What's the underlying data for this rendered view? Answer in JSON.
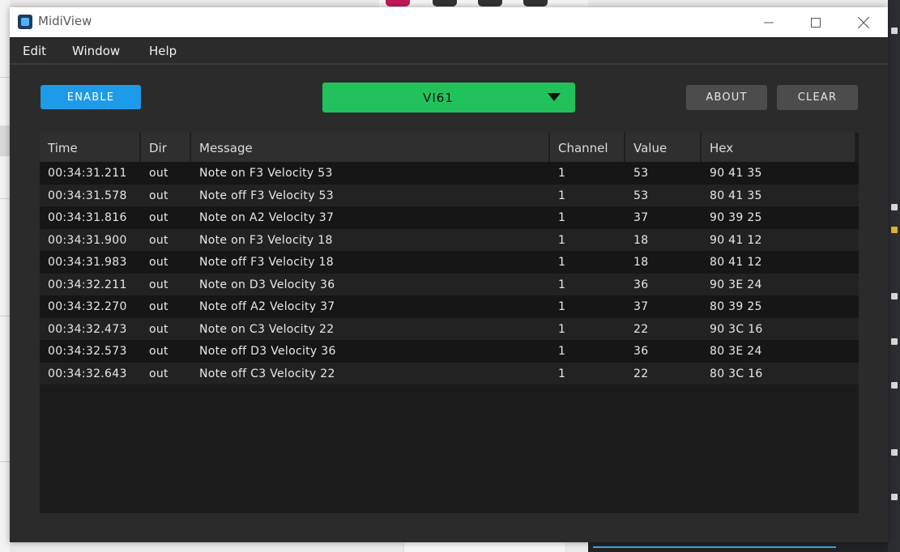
{
  "window": {
    "title": "MidiView"
  },
  "menu": [
    "Edit",
    "Window",
    "Help"
  ],
  "toolbar": {
    "enable_label": "ENABLE",
    "device_selected": "VI61",
    "about_label": "ABOUT",
    "clear_label": "CLEAR"
  },
  "colors": {
    "enable": "#1e9be8",
    "device_select": "#21c25b",
    "buttons": "#4c4c4c",
    "window_bg": "#2b2b2b"
  },
  "table": {
    "columns": [
      "Time",
      "Dir",
      "Message",
      "Channel",
      "Value",
      "Hex"
    ],
    "rows": [
      [
        "00:34:31.211",
        "out",
        "Note on F3 Velocity 53",
        "1",
        "53",
        "90 41 35"
      ],
      [
        "00:34:31.578",
        "out",
        "Note off F3 Velocity 53",
        "1",
        "53",
        "80 41 35"
      ],
      [
        "00:34:31.816",
        "out",
        "Note on A2 Velocity 37",
        "1",
        "37",
        "90 39 25"
      ],
      [
        "00:34:31.900",
        "out",
        "Note on F3 Velocity 18",
        "1",
        "18",
        "90 41 12"
      ],
      [
        "00:34:31.983",
        "out",
        "Note off F3 Velocity 18",
        "1",
        "18",
        "80 41 12"
      ],
      [
        "00:34:32.211",
        "out",
        "Note on D3 Velocity 36",
        "1",
        "36",
        "90 3E 24"
      ],
      [
        "00:34:32.270",
        "out",
        "Note off A2 Velocity 37",
        "1",
        "37",
        "80 39 25"
      ],
      [
        "00:34:32.473",
        "out",
        "Note on C3 Velocity 22",
        "1",
        "22",
        "90 3C 16"
      ],
      [
        "00:34:32.573",
        "out",
        "Note off D3 Velocity 36",
        "1",
        "36",
        "80 3E 24"
      ],
      [
        "00:34:32.643",
        "out",
        "Note off C3 Velocity 22",
        "1",
        "22",
        "80 3C 16"
      ]
    ]
  }
}
